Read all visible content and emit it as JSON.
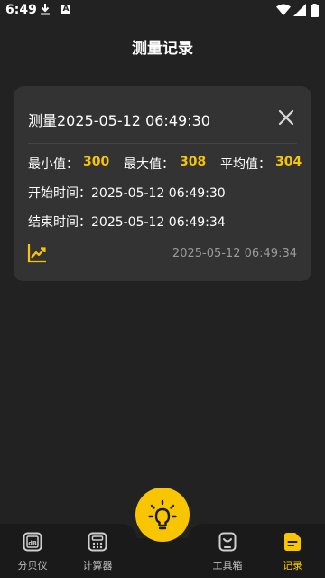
{
  "status_bar": {
    "time": "6:49"
  },
  "header": {
    "title": "测量记录"
  },
  "record": {
    "title": "测量2025-05-12 06:49:30",
    "min_label": "最小值：",
    "min_value": "300",
    "max_label": "最大值：",
    "max_value": "308",
    "avg_label": "平均值：",
    "avg_value": "304",
    "start_label": "开始时间：",
    "start_value": "2025-05-12 06:49:30",
    "end_label": "结束时间：",
    "end_value": "2025-05-12 06:49:34",
    "footer_time": "2025-05-12 06:49:34"
  },
  "bottom_nav": {
    "items": [
      {
        "label": "分贝仪",
        "icon": "db-meter-icon"
      },
      {
        "label": "计算器",
        "icon": "calculator-icon"
      },
      {
        "label": "工具箱",
        "icon": "toolbox-icon"
      },
      {
        "label": "记录",
        "icon": "records-icon",
        "active": true
      }
    ],
    "center_icon": "light-bulb-icon"
  },
  "colors": {
    "accent": "#F7C600",
    "background": "#222222",
    "card": "#333333",
    "muted_text": "#9a9a9a"
  }
}
